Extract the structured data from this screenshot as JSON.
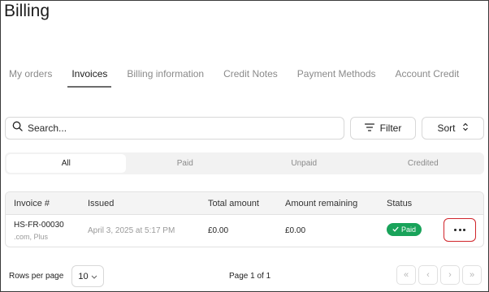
{
  "page": {
    "title": "Billing"
  },
  "tabs": [
    {
      "label": "My orders",
      "active": false
    },
    {
      "label": "Invoices",
      "active": true
    },
    {
      "label": "Billing information",
      "active": false
    },
    {
      "label": "Credit Notes",
      "active": false
    },
    {
      "label": "Payment Methods",
      "active": false
    },
    {
      "label": "Account Credit",
      "active": false
    }
  ],
  "toolbar": {
    "search_placeholder": "Search...",
    "filter_label": "Filter",
    "sort_label": "Sort",
    "search_icon": "search-icon",
    "filter_icon": "filter-lines-icon",
    "sort_icon": "chevron-up-down-icon"
  },
  "status_filter": {
    "options": [
      "All",
      "Paid",
      "Unpaid",
      "Credited"
    ],
    "selected": "All"
  },
  "table": {
    "columns": [
      "Invoice #",
      "Issued",
      "Total amount",
      "Amount remaining",
      "Status"
    ],
    "rows": [
      {
        "invoice_number": "HS-FR-00030",
        "invoice_sub": ".com, Plus",
        "issued": "April 3, 2025 at 5:17 PM",
        "total_amount": "£0.00",
        "amount_remaining": "£0.00",
        "status": "Paid",
        "status_color": "#19a35a",
        "actions_icon": "more-horizontal-icon"
      }
    ]
  },
  "pagination": {
    "rows_per_page_label": "Rows per page",
    "rows_per_page": "10",
    "page_info": "Page 1 of 1",
    "first": "«",
    "prev": "‹",
    "next": "›",
    "last": "»"
  },
  "colors": {
    "accent_green": "#19a35a",
    "highlight_red": "#d0242a"
  }
}
